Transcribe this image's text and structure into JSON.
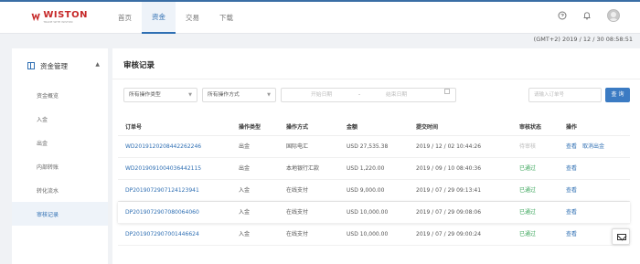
{
  "brand": {
    "name": "WISTON",
    "tagline": "TRADE WITH WISTON"
  },
  "nav": [
    {
      "label": "首页"
    },
    {
      "label": "资金"
    },
    {
      "label": "交易"
    },
    {
      "label": "下载"
    }
  ],
  "top_icons": [
    "help-circle-icon",
    "bell-icon",
    "user-avatar"
  ],
  "timestamp": "(GMT+2) 2019 / 12 / 30 08:58:51",
  "sidebar": {
    "group": "资金管理",
    "items": [
      {
        "label": "资金概览"
      },
      {
        "label": "入金"
      },
      {
        "label": "出金"
      },
      {
        "label": "内部转账"
      },
      {
        "label": "转化流水"
      },
      {
        "label": "审核记录"
      }
    ]
  },
  "main": {
    "title": "审核记录",
    "filters": {
      "op_type": "所有操作类型",
      "op_method": "所有操作方式",
      "start_date": "开始日期",
      "sep": "-",
      "end_date": "结束日期",
      "order_placeholder": "请输入订单号",
      "search_label": "查 询"
    },
    "table": {
      "headers": [
        "订单号",
        "操作类型",
        "操作方式",
        "金额",
        "提交时间",
        "审核状态",
        "操作"
      ],
      "rows": [
        {
          "order": "WD2019120208442262246",
          "type": "出金",
          "method": "国际电汇",
          "amount": "USD 27,535.38",
          "time": "2019 / 12 / 02 10:44:26",
          "status": "待审核",
          "status_kind": "pending",
          "actions": [
            "查看",
            "取消出金"
          ]
        },
        {
          "order": "WD2019091004036442115",
          "type": "出金",
          "method": "本地银行汇款",
          "amount": "USD 1,220.00",
          "time": "2019 / 09 / 10 08:40:36",
          "status": "已通过",
          "status_kind": "ok",
          "actions": [
            "查看"
          ]
        },
        {
          "order": "DP2019072907124123941",
          "type": "入金",
          "method": "在线支付",
          "amount": "USD 9,000.00",
          "time": "2019 / 07 / 29 09:13:41",
          "status": "已通过",
          "status_kind": "ok",
          "actions": [
            "查看"
          ]
        },
        {
          "order": "DP2019072907080064060",
          "type": "入金",
          "method": "在线支付",
          "amount": "USD 10,000.00",
          "time": "2019 / 07 / 29 09:08:06",
          "status": "已通过",
          "status_kind": "ok",
          "actions": [
            "查看"
          ]
        },
        {
          "order": "DP2019072907001446624",
          "type": "入金",
          "method": "在线支付",
          "amount": "USD 10,000.00",
          "time": "2019 / 07 / 29 09:00:24",
          "status": "已通过",
          "status_kind": "ok",
          "actions": [
            "查看"
          ]
        }
      ]
    }
  },
  "colors": {
    "accent": "#2f6fb3",
    "brand_red": "#c62828",
    "success": "#3aa55a",
    "button": "#3b7bc3"
  }
}
